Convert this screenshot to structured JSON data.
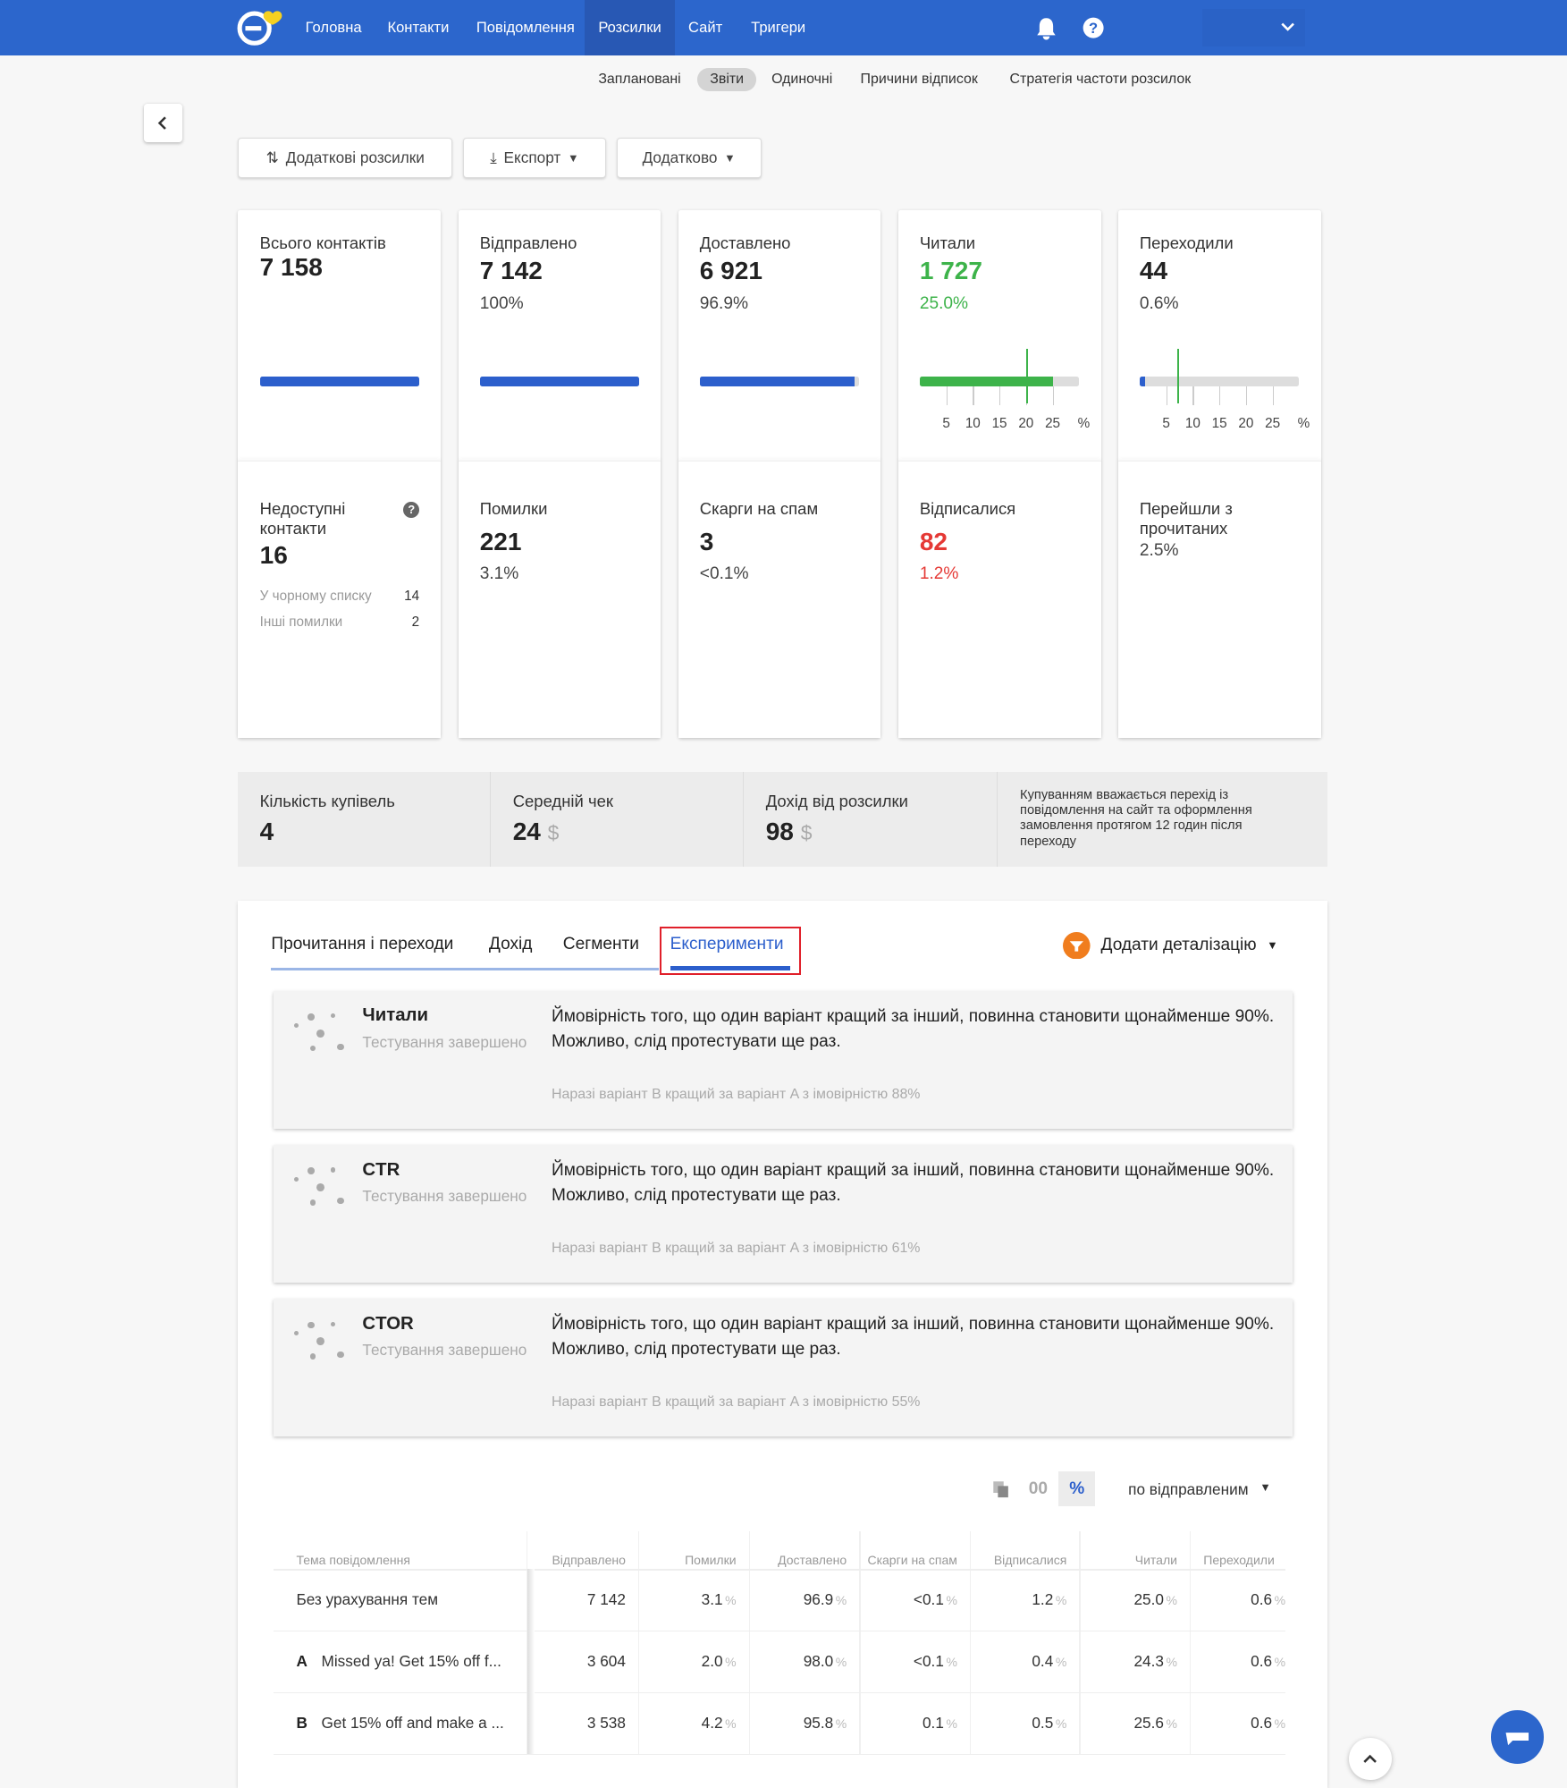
{
  "nav": {
    "items": [
      "Головна",
      "Контакти",
      "Повідомлення",
      "Розсилки",
      "Сайт",
      "Тригери"
    ],
    "active": 3,
    "accent": "#2c66cc"
  },
  "subnav": {
    "items": [
      "Заплановані",
      "Звіти",
      "Одиночні",
      "Причини відписок",
      "Стратегія частоти розсилок"
    ],
    "active": 1
  },
  "toolbar": {
    "extra": "Додаткові розсилки",
    "export": "Експорт",
    "more": "Додатково"
  },
  "cards": [
    {
      "label": "Всього контактів",
      "value": "7 158",
      "pct": "",
      "bar": 100,
      "lower_label": "Недоступні контакти",
      "lower_value": "16",
      "lower_pct": "",
      "details": [
        {
          "label": "У чорному списку",
          "value": "14"
        },
        {
          "label": "Інші помилки",
          "value": "2"
        }
      ]
    },
    {
      "label": "Відправлено",
      "value": "7 142",
      "pct": "100%",
      "bar": 100,
      "lower_label": "Помилки",
      "lower_value": "221",
      "lower_pct": "3.1%"
    },
    {
      "label": "Доставлено",
      "value": "6 921",
      "pct": "96.9%",
      "bar": 96.9,
      "lower_label": "Скарги на спам",
      "lower_value": "3",
      "lower_pct": "<0.1%"
    },
    {
      "label": "Читали",
      "value": "1 727",
      "pct": "25.0%",
      "scale": true,
      "fill": 25.0,
      "marker": 20,
      "color": "#3db34a",
      "lower_label": "Відписалися",
      "lower_value": "82",
      "lower_pct": "1.2%",
      "lower_color": "#e53935"
    },
    {
      "label": "Переходили",
      "value": "44",
      "pct": "0.6%",
      "scale": true,
      "fill": 0.6,
      "marker": 7,
      "color": "#2c5fcc",
      "lower_label": "Перейшли з прочитаних",
      "lower_value": "",
      "lower_pct": "2.5%"
    }
  ],
  "scale_ticks": [
    "5",
    "10",
    "15",
    "20",
    "25",
    "%"
  ],
  "purchases": [
    {
      "label": "Кількість купівель",
      "value": "4"
    },
    {
      "label": "Середній чек",
      "value": "24",
      "unit": "$"
    },
    {
      "label": "Дохід від розсилки",
      "value": "98",
      "unit": "$"
    }
  ],
  "purchases_note": "Купуванням вважається перехід із повідомлення на сайт та оформлення замовлення протягом 12 годин після переходу",
  "tabs": [
    "Прочитання і переходи",
    "Дохід",
    "Сегменти",
    "Експерименти"
  ],
  "active_tab": 3,
  "detail_button": "Додати деталізацію",
  "experiments": [
    {
      "name": "Читали",
      "status": "Тестування завершено",
      "msg": "Ймовірність того, що один варіант кращий за інший, повинна становити щонайменше 90%.",
      "msg2": "Можливо, слід протестувати ще раз.",
      "note": "Наразі варіант B кращий за варіант A з імовірністю 88%"
    },
    {
      "name": "CTR",
      "status": "Тестування завершено",
      "msg": "Ймовірність того, що один варіант кращий за інший, повинна становити щонайменше 90%.",
      "msg2": "Можливо, слід протестувати ще раз.",
      "note": "Наразі варіант B кращий за варіант A з імовірністю 61%"
    },
    {
      "name": "CTOR",
      "status": "Тестування завершено",
      "msg": "Ймовірність того, що один варіант кращий за інший, повинна становити щонайменше 90%.",
      "msg2": "Можливо, слід протестувати ще раз.",
      "note": "Наразі варіант B кращий за варіант A з імовірністю 55%"
    }
  ],
  "view": {
    "abs": "00",
    "pct": "%",
    "basis": "по відправленим"
  },
  "table": {
    "columns": [
      "Тема повідомлення",
      "Відправлено",
      "Помилки",
      "Доставлено",
      "Скарги на спам",
      "Відписалися",
      "Читали",
      "Переходили"
    ],
    "rows": [
      {
        "variant": "",
        "subject": "Без урахування тем",
        "cells": [
          "7 142",
          "3.1",
          "96.9",
          "<0.1",
          "1.2",
          "25.0",
          "0.6"
        ]
      },
      {
        "variant": "A",
        "subject": "Missed ya! Get 15% off f...",
        "cells": [
          "3 604",
          "2.0",
          "98.0",
          "<0.1",
          "0.4",
          "24.3",
          "0.6"
        ]
      },
      {
        "variant": "B",
        "subject": "Get 15% off and make a ...",
        "cells": [
          "3 538",
          "4.2",
          "95.8",
          "0.1",
          "0.5",
          "25.6",
          "0.6"
        ]
      }
    ],
    "unit": "%"
  }
}
